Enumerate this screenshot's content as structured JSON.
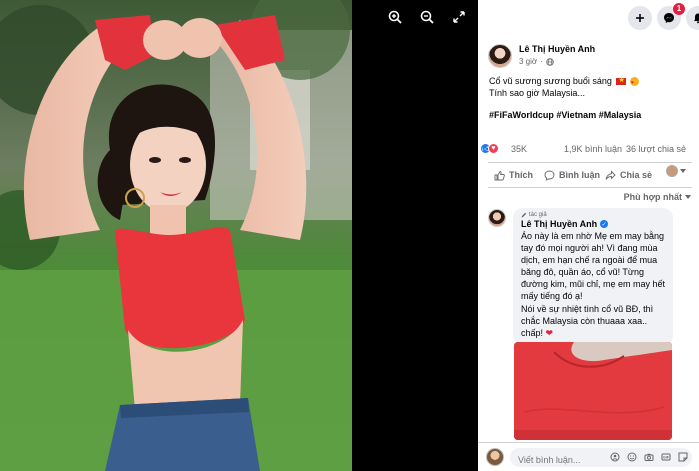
{
  "viewer": {
    "tools": [
      "zoom-in-icon",
      "zoom-out-icon",
      "fullscreen-icon"
    ]
  },
  "topbar": {
    "notification_count": "1"
  },
  "post": {
    "author": "Lê Thị Huyền Anh",
    "time": "3 giờ",
    "line1": "Cổ vũ sương sương buổi sáng",
    "line2": "Tính sao giờ Malaysia...",
    "hashtags": "#FiFaWorldcup #Vietnam #Malaysia",
    "reaction_count": "35K",
    "comment_count": "1,9K bình luận",
    "share_count": "36 lượt chia sẻ"
  },
  "actions": {
    "like": "Thích",
    "comment": "Bình luận",
    "share": "Chia sẻ"
  },
  "sort_label": "Phù hợp nhất",
  "comment": {
    "tag": "tác giả",
    "author": "Lê Thị Huyền Anh",
    "text": "Áo này là em nhờ Mẹ em may bằng tay đó mọi người ah! Vì đang mùa dịch, em hạn chế ra ngoài để mua băng đô, quần áo, cổ vũ! Từng đường kim, mũi chỉ, mẹ em may hết mấy tiếng đó ạ!",
    "text2": "Nói về sự nhiệt tình cổ vũ BĐ, thì chắc Malaysia còn thuaaa xaa.. chấp!",
    "heart": "❤"
  },
  "composer": {
    "placeholder": "Viết bình luận..."
  },
  "colors": {
    "accent": "#1877f2",
    "love": "#f33e58",
    "shirt": "#e8363c"
  }
}
